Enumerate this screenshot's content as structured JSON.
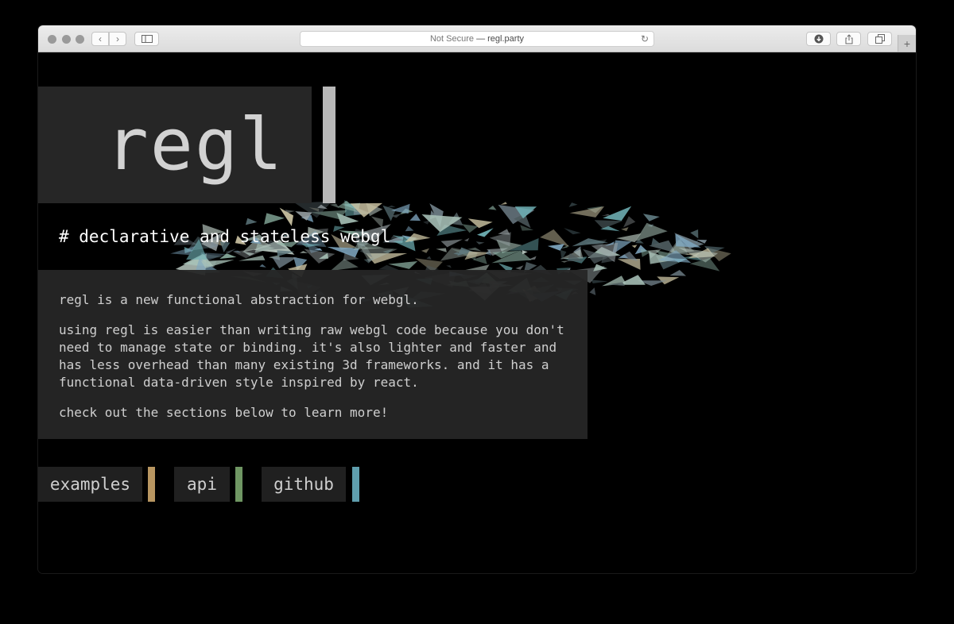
{
  "browser": {
    "url_secure_text": "Not Secure",
    "url_separator": " — ",
    "url_host": "regl.party",
    "reload_glyph": "↻",
    "back_glyph": "‹",
    "forward_glyph": "›",
    "newtab_glyph": "+"
  },
  "page": {
    "logo": "regl",
    "tagline": "# declarative and stateless webgl",
    "paragraphs": [
      "regl is a new functional abstraction for webgl.",
      "using regl is easier than writing raw webgl code because you don't need to manage state or binding. it's also lighter and faster and has less overhead than many existing 3d frameworks. and it has a functional data-driven style inspired by react.",
      "check out the sections below to learn more!"
    ],
    "nav": [
      {
        "label": "examples",
        "accent": "#b89661"
      },
      {
        "label": "api",
        "accent": "#6f9663"
      },
      {
        "label": "github",
        "accent": "#5f9ead"
      }
    ]
  },
  "colors": {
    "logo_bar": "#b8b8b8",
    "panel": "#262626"
  }
}
